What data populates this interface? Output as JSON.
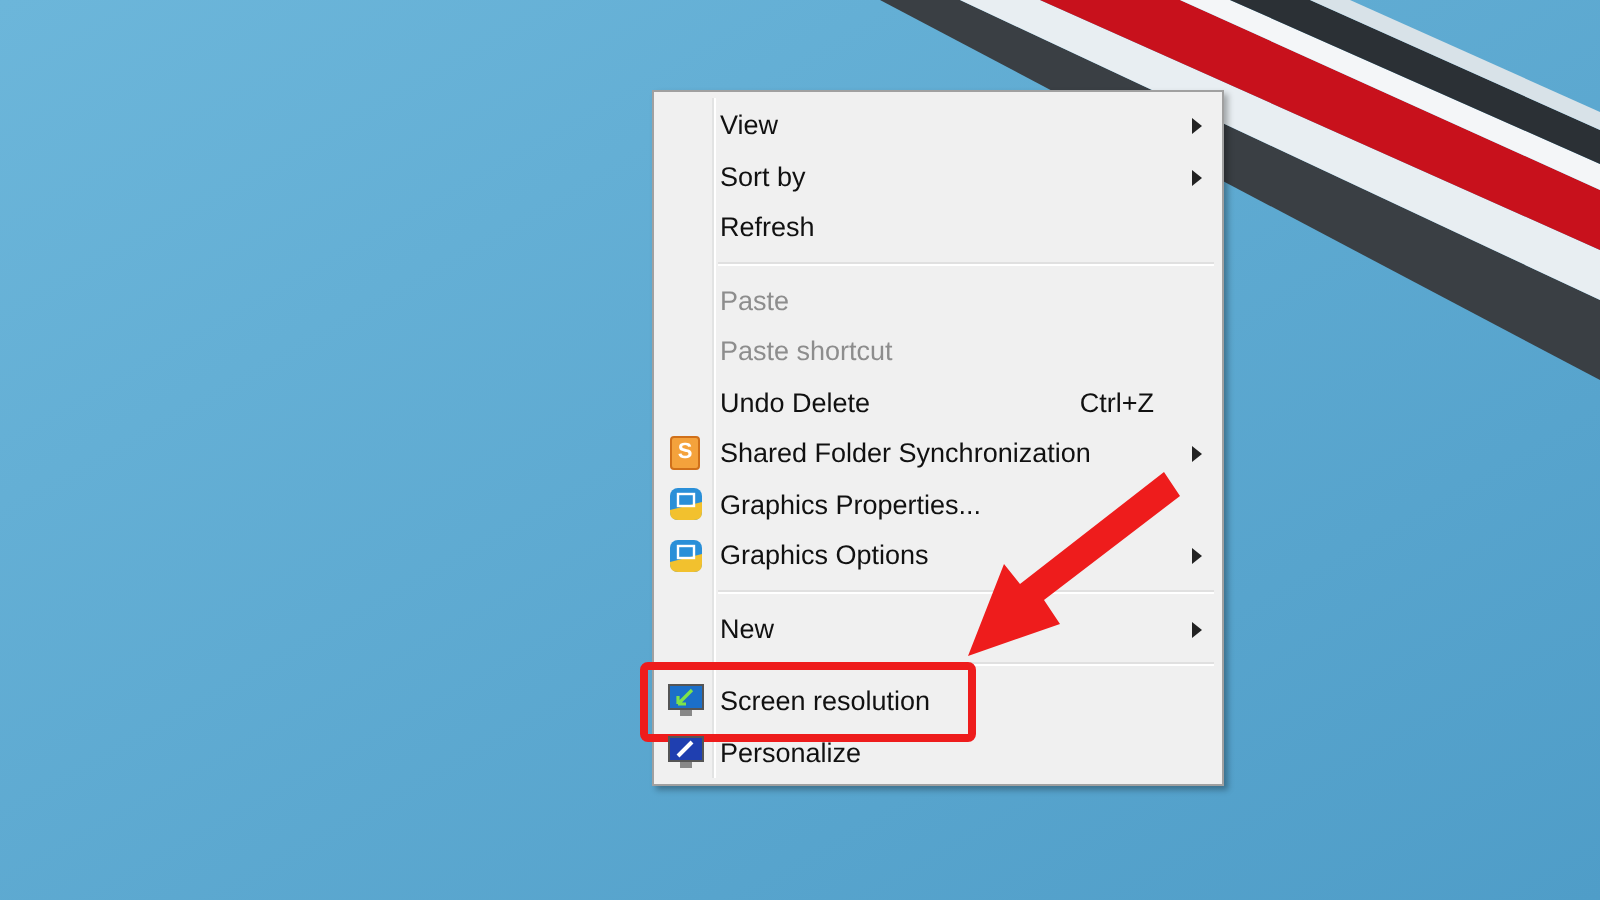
{
  "context_menu": {
    "entries": [
      {
        "kind": "item",
        "label": "View",
        "disabled": false,
        "submenu": true
      },
      {
        "kind": "item",
        "label": "Sort by",
        "disabled": false,
        "submenu": true
      },
      {
        "kind": "item",
        "label": "Refresh",
        "disabled": false,
        "submenu": false
      },
      {
        "kind": "separator"
      },
      {
        "kind": "item",
        "label": "Paste",
        "disabled": true,
        "submenu": false
      },
      {
        "kind": "item",
        "label": "Paste shortcut",
        "disabled": true,
        "submenu": false
      },
      {
        "kind": "item",
        "label": "Undo Delete",
        "disabled": false,
        "submenu": false,
        "shortcut": "Ctrl+Z"
      },
      {
        "kind": "item",
        "label": "Shared Folder Synchronization",
        "disabled": false,
        "submenu": true,
        "icon_letter": "S"
      },
      {
        "kind": "item",
        "label": "Graphics Properties...",
        "disabled": false,
        "submenu": false
      },
      {
        "kind": "item",
        "label": "Graphics Options",
        "disabled": false,
        "submenu": true
      },
      {
        "kind": "separator"
      },
      {
        "kind": "item",
        "label": "New",
        "disabled": false,
        "submenu": true
      },
      {
        "kind": "separator"
      },
      {
        "kind": "item",
        "label": "Screen resolution",
        "disabled": false,
        "submenu": false,
        "highlighted": true
      },
      {
        "kind": "item",
        "label": "Personalize",
        "disabled": false,
        "submenu": false
      }
    ]
  }
}
